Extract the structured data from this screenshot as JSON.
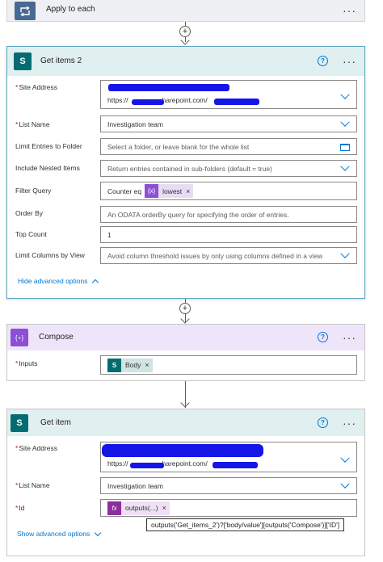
{
  "apply_to_each": {
    "title": "Apply to each"
  },
  "get_items": {
    "title": "Get items 2",
    "site_address_label": "Site Address",
    "site_address_url": "https://",
    "site_address_url_suffix": "harepoint.com/",
    "list_name_label": "List Name",
    "list_name_value": "Investigation team",
    "limit_folder_label": "Limit Entries to Folder",
    "limit_folder_placeholder": "Select a folder, or leave blank for the whole list",
    "nested_label": "Include Nested Items",
    "nested_placeholder": "Return entries contained in sub-folders (default = true)",
    "filter_label": "Filter Query",
    "filter_text": "Counter eq",
    "filter_token": "lowest",
    "order_label": "Order By",
    "order_placeholder": "An ODATA orderBy query for specifying the order of entries.",
    "top_label": "Top Count",
    "top_value": "1",
    "limit_columns_label": "Limit Columns by View",
    "limit_columns_placeholder": "Avoid column threshold issues by only using columns defined in a view",
    "hide_advanced": "Hide advanced options"
  },
  "compose": {
    "title": "Compose",
    "inputs_label": "Inputs",
    "token_label": "Body"
  },
  "get_item": {
    "title": "Get item",
    "site_address_label": "Site Address",
    "site_address_url": "https://",
    "site_address_url_suffix": "harepoint.com/",
    "list_name_label": "List Name",
    "list_name_value": "Investigation team",
    "id_label": "Id",
    "id_token": "outputs(...)",
    "show_advanced": "Show advanced options",
    "tooltip": "outputs('Get_items_2')?['body/value'][outputs('Compose')]['ID']"
  },
  "symbols": {
    "required": "*",
    "more": "···",
    "help": "?",
    "plus": "+",
    "remove": "×",
    "var_glyph": "{x}",
    "fx_glyph": "fx",
    "compose_glyph": "{∘}",
    "sp_glyph": "S"
  },
  "colors": {
    "sharepoint": "#036c70",
    "compose": "#8c4fd6",
    "loop": "#486991",
    "link": "#0078d4",
    "required": "#a4262c",
    "redaction": "#1515e8"
  }
}
